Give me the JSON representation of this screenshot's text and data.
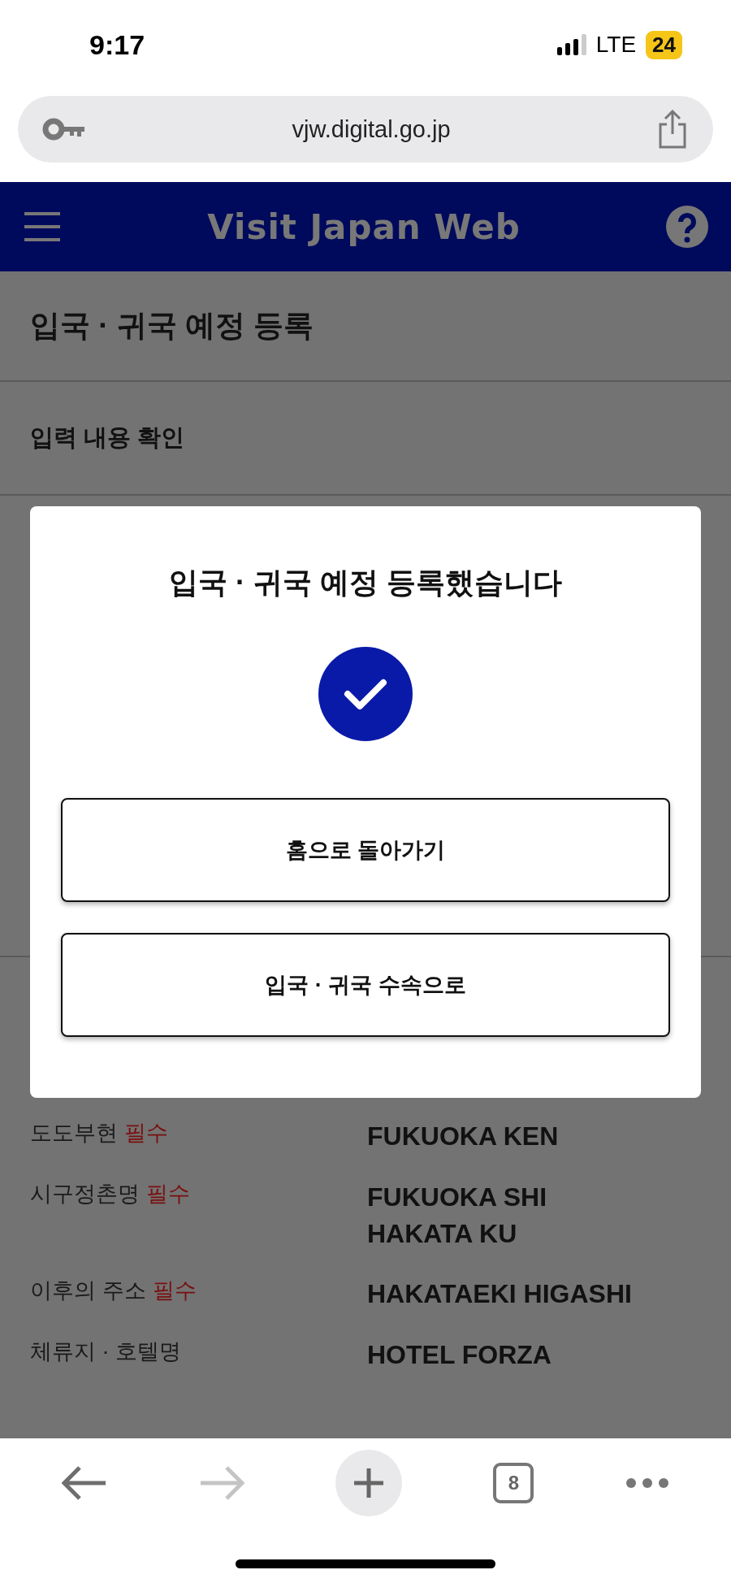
{
  "status_bar": {
    "time": "9:17",
    "network": "LTE",
    "battery": "24"
  },
  "browser": {
    "url": "vjw.digital.go.jp",
    "tab_count": "8"
  },
  "header": {
    "title": "Visit Japan Web"
  },
  "page": {
    "title": "입국 · 귀국 예정 등록",
    "subtitle": "입력 내용 확인",
    "fields": [
      {
        "label": "도도부현",
        "badge": "필수",
        "value_lines": [
          "FUKUOKA KEN"
        ]
      },
      {
        "label": "시구정촌명",
        "badge": "필수",
        "value_lines": [
          "FUKUOKA SHI",
          "HAKATA KU"
        ]
      },
      {
        "label": "이후의 주소",
        "badge": "필수",
        "value_lines": [
          "HAKATAEKI HIGASHI"
        ]
      },
      {
        "label": "체류지 · 호텔명",
        "value_lines": [
          "HOTEL FORZA"
        ]
      }
    ]
  },
  "dialog": {
    "title": "입국 · 귀국 예정 등록했습니다",
    "buttons": [
      "홈으로 돌아가기",
      "입국 · 귀국 수속으로"
    ]
  }
}
